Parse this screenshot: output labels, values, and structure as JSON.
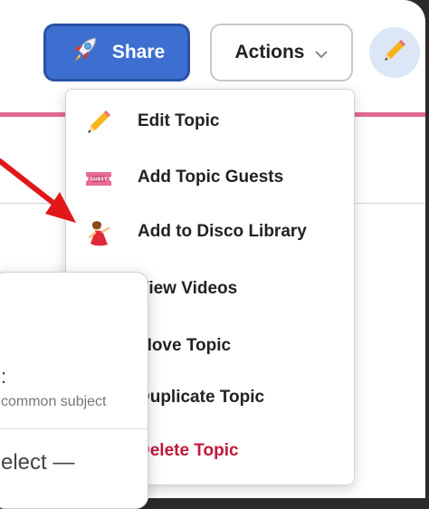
{
  "header": {
    "share_label": "Share",
    "actions_label": "Actions",
    "share_icon": "rocket-icon",
    "actions_icon": "chevron-down-icon",
    "avatar_icon": "pencil-icon"
  },
  "menu": {
    "items": [
      {
        "label": "Edit Topic",
        "icon": "pencil-icon"
      },
      {
        "label": "Add Topic Guests",
        "icon": "guest-ticket-icon"
      },
      {
        "label": "Add to Disco Library",
        "icon": "dancer-icon"
      },
      {
        "label": "View Videos",
        "icon": ""
      },
      {
        "label": "Move Topic",
        "icon": ""
      },
      {
        "label": "Duplicate Topic",
        "icon": ""
      },
      {
        "label": "Delete Topic",
        "icon": ""
      }
    ]
  },
  "panel": {
    "colon_text": ":",
    "subject_text": "common subject",
    "select_text": "elect —"
  },
  "colors": {
    "share_bg": "#3c6fd0",
    "accent_line": "#e06a91",
    "danger": "#c0183b",
    "arrow": "#e01818"
  }
}
